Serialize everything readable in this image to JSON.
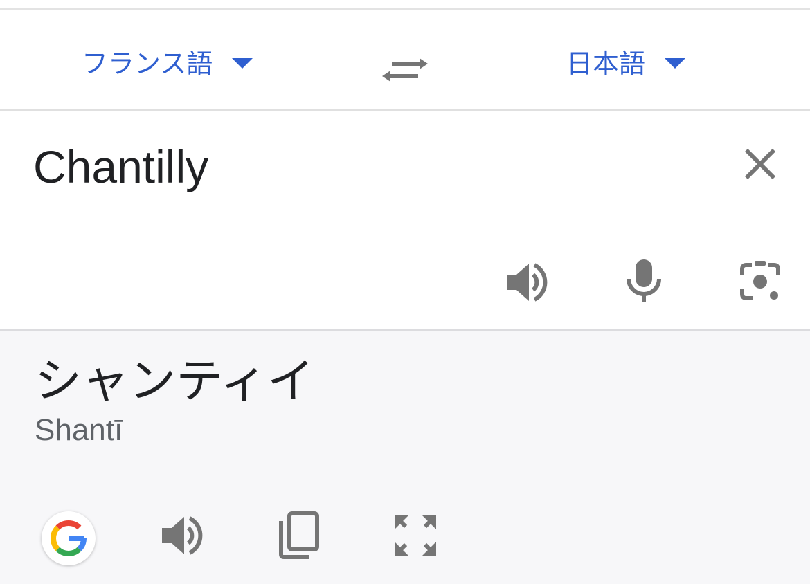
{
  "language_bar": {
    "source_language": "フランス語",
    "target_language": "日本語",
    "swap_icon": "swap-arrows-icon"
  },
  "input": {
    "text": "Chantilly",
    "clear_icon": "close-icon",
    "actions": [
      "speaker-icon",
      "microphone-icon",
      "camera-lens-icon"
    ]
  },
  "output": {
    "translation": "シャンティイ",
    "romanization": "Shantī",
    "actions": [
      "google-logo-icon",
      "speaker-icon",
      "copy-icon",
      "fullscreen-icon"
    ]
  },
  "colors": {
    "accent": "#2f5fd0",
    "icon": "#757575",
    "output_background": "#f7f7f9",
    "text": "#202124"
  }
}
